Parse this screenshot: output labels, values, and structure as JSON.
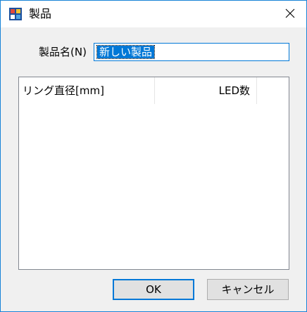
{
  "window": {
    "title": "製品",
    "app_icon": "app-window-icon",
    "close_icon": "close-icon",
    "accent_color": "#1883d7"
  },
  "form": {
    "name_label": "製品名(N)",
    "name_value": "新しい製品"
  },
  "list": {
    "columns": [
      "リング直径[mm]",
      "LED数"
    ],
    "rows": []
  },
  "buttons": {
    "ok": "OK",
    "cancel": "キャンセル"
  }
}
